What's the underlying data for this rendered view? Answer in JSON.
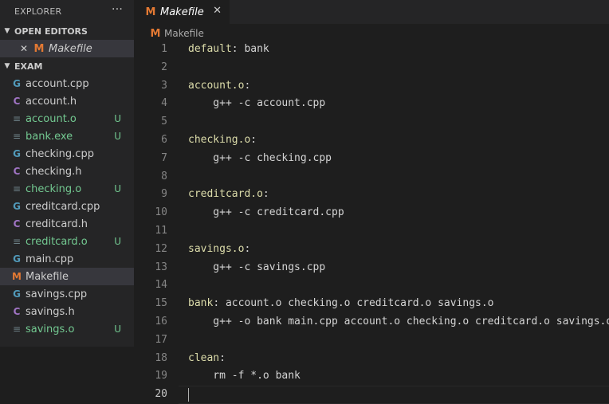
{
  "explorer": {
    "title": "EXPLORER",
    "more_label": "···",
    "open_editors": {
      "label": "OPEN EDITORS",
      "items": [
        {
          "icon": "M",
          "name": "Makefile",
          "close": "✕"
        }
      ]
    },
    "workspace": {
      "label": "EXAM",
      "files": [
        {
          "icon": "cpp",
          "glyph": "G",
          "name": "account.cpp",
          "badge": ""
        },
        {
          "icon": "h",
          "glyph": "C",
          "name": "account.h",
          "badge": ""
        },
        {
          "icon": "lines",
          "glyph": "≡",
          "name": "account.o",
          "badge": "U"
        },
        {
          "icon": "lines",
          "glyph": "≡",
          "name": "bank.exe",
          "badge": "U"
        },
        {
          "icon": "cpp",
          "glyph": "G",
          "name": "checking.cpp",
          "badge": ""
        },
        {
          "icon": "h",
          "glyph": "C",
          "name": "checking.h",
          "badge": ""
        },
        {
          "icon": "lines",
          "glyph": "≡",
          "name": "checking.o",
          "badge": "U"
        },
        {
          "icon": "cpp",
          "glyph": "G",
          "name": "creditcard.cpp",
          "badge": ""
        },
        {
          "icon": "h",
          "glyph": "C",
          "name": "creditcard.h",
          "badge": ""
        },
        {
          "icon": "lines",
          "glyph": "≡",
          "name": "creditcard.o",
          "badge": "U"
        },
        {
          "icon": "cpp",
          "glyph": "G",
          "name": "main.cpp",
          "badge": ""
        },
        {
          "icon": "m",
          "glyph": "M",
          "name": "Makefile",
          "badge": "",
          "selected": true
        },
        {
          "icon": "cpp",
          "glyph": "G",
          "name": "savings.cpp",
          "badge": ""
        },
        {
          "icon": "h",
          "glyph": "C",
          "name": "savings.h",
          "badge": ""
        },
        {
          "icon": "lines",
          "glyph": "≡",
          "name": "savings.o",
          "badge": "U"
        }
      ]
    }
  },
  "tab": {
    "icon": "M",
    "label": "Makefile",
    "close": "✕"
  },
  "breadcrumb": {
    "icon": "M",
    "label": "Makefile"
  },
  "editor": {
    "lines": [
      {
        "n": "1",
        "target": "default",
        "rest": ": bank"
      },
      {
        "n": "2",
        "target": "",
        "rest": ""
      },
      {
        "n": "3",
        "target": "account.o",
        "rest": ":"
      },
      {
        "n": "4",
        "target": "",
        "rest": "    g++ -c account.cpp"
      },
      {
        "n": "5",
        "target": "",
        "rest": ""
      },
      {
        "n": "6",
        "target": "checking.o",
        "rest": ":"
      },
      {
        "n": "7",
        "target": "",
        "rest": "    g++ -c checking.cpp"
      },
      {
        "n": "8",
        "target": "",
        "rest": ""
      },
      {
        "n": "9",
        "target": "creditcard.o",
        "rest": ":"
      },
      {
        "n": "10",
        "target": "",
        "rest": "    g++ -c creditcard.cpp"
      },
      {
        "n": "11",
        "target": "",
        "rest": ""
      },
      {
        "n": "12",
        "target": "savings.o",
        "rest": ":"
      },
      {
        "n": "13",
        "target": "",
        "rest": "    g++ -c savings.cpp"
      },
      {
        "n": "14",
        "target": "",
        "rest": ""
      },
      {
        "n": "15",
        "target": "bank",
        "rest": ": account.o checking.o creditcard.o savings.o"
      },
      {
        "n": "16",
        "target": "",
        "rest": "    g++ -o bank main.cpp account.o checking.o creditcard.o savings.o"
      },
      {
        "n": "17",
        "target": "",
        "rest": ""
      },
      {
        "n": "18",
        "target": "clean",
        "rest": ":"
      },
      {
        "n": "19",
        "target": "",
        "rest": "    rm -f *.o bank"
      },
      {
        "n": "20",
        "target": "",
        "rest": ""
      }
    ],
    "current_line": "20"
  },
  "colors": {
    "accent_makefile": "#e37933",
    "cpp_icon": "#519aba",
    "h_icon": "#a074c4",
    "untracked": "#73c991",
    "target": "#dcdcaa"
  }
}
